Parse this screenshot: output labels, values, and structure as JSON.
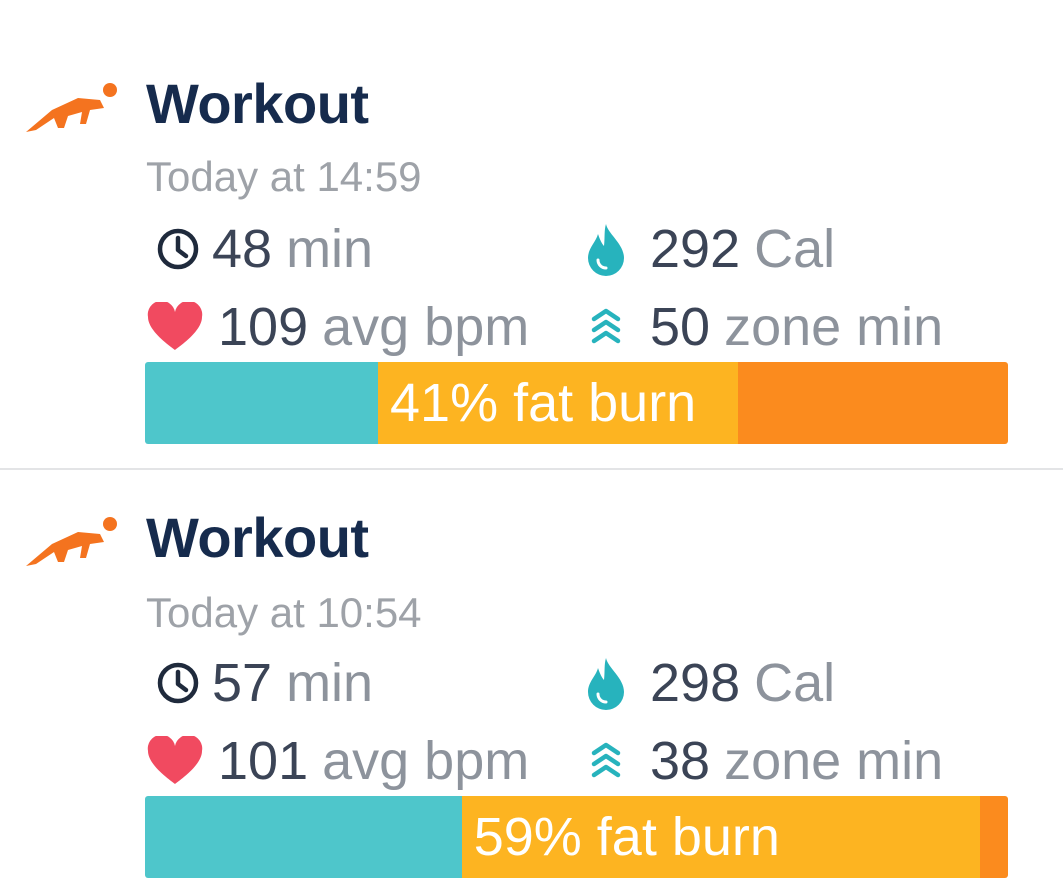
{
  "workouts": [
    {
      "activity_icon": "running-figure-icon",
      "title": "Workout",
      "timestamp": "Today at 14:59",
      "duration": {
        "value": "48",
        "unit": "min",
        "icon": "clock-icon"
      },
      "calories": {
        "value": "292",
        "unit": "Cal",
        "icon": "flame-icon"
      },
      "heart_rate": {
        "value": "109",
        "unit": "avg bpm",
        "icon": "heart-icon"
      },
      "zone": {
        "value": "50",
        "unit": "zone min",
        "icon": "zone-chevrons-icon"
      },
      "zone_bar": {
        "label": "41% fat burn",
        "segments": [
          {
            "zone": "below-zones",
            "fraction": 0.27,
            "color": "#4ec6cb"
          },
          {
            "zone": "fat-burn",
            "fraction": 0.417,
            "color": "#fdb421"
          },
          {
            "zone": "cardio",
            "fraction": 0.313,
            "color": "#fb8b1e"
          }
        ]
      }
    },
    {
      "activity_icon": "running-figure-icon",
      "title": "Workout",
      "timestamp": "Today at 10:54",
      "duration": {
        "value": "57",
        "unit": "min",
        "icon": "clock-icon"
      },
      "calories": {
        "value": "298",
        "unit": "Cal",
        "icon": "flame-icon"
      },
      "heart_rate": {
        "value": "101",
        "unit": "avg bpm",
        "icon": "heart-icon"
      },
      "zone": {
        "value": "38",
        "unit": "zone min",
        "icon": "zone-chevrons-icon"
      },
      "zone_bar": {
        "label": "59% fat burn",
        "segments": [
          {
            "zone": "below-zones",
            "fraction": 0.367,
            "color": "#4ec6cb"
          },
          {
            "zone": "fat-burn",
            "fraction": 0.6,
            "color": "#fdb421"
          },
          {
            "zone": "cardio",
            "fraction": 0.033,
            "color": "#fb8b1e"
          }
        ]
      }
    }
  ],
  "colors": {
    "title": "#162b4d",
    "timestamp": "#9ea2a8",
    "value": "#3b4456",
    "unit": "#8d939c",
    "activity_icon": "#f4731f",
    "clock_icon": "#1f2a3c",
    "flame_icon": "#27b3bd",
    "heart_icon": "#f14a60",
    "zone_icon": "#27b3bd"
  }
}
